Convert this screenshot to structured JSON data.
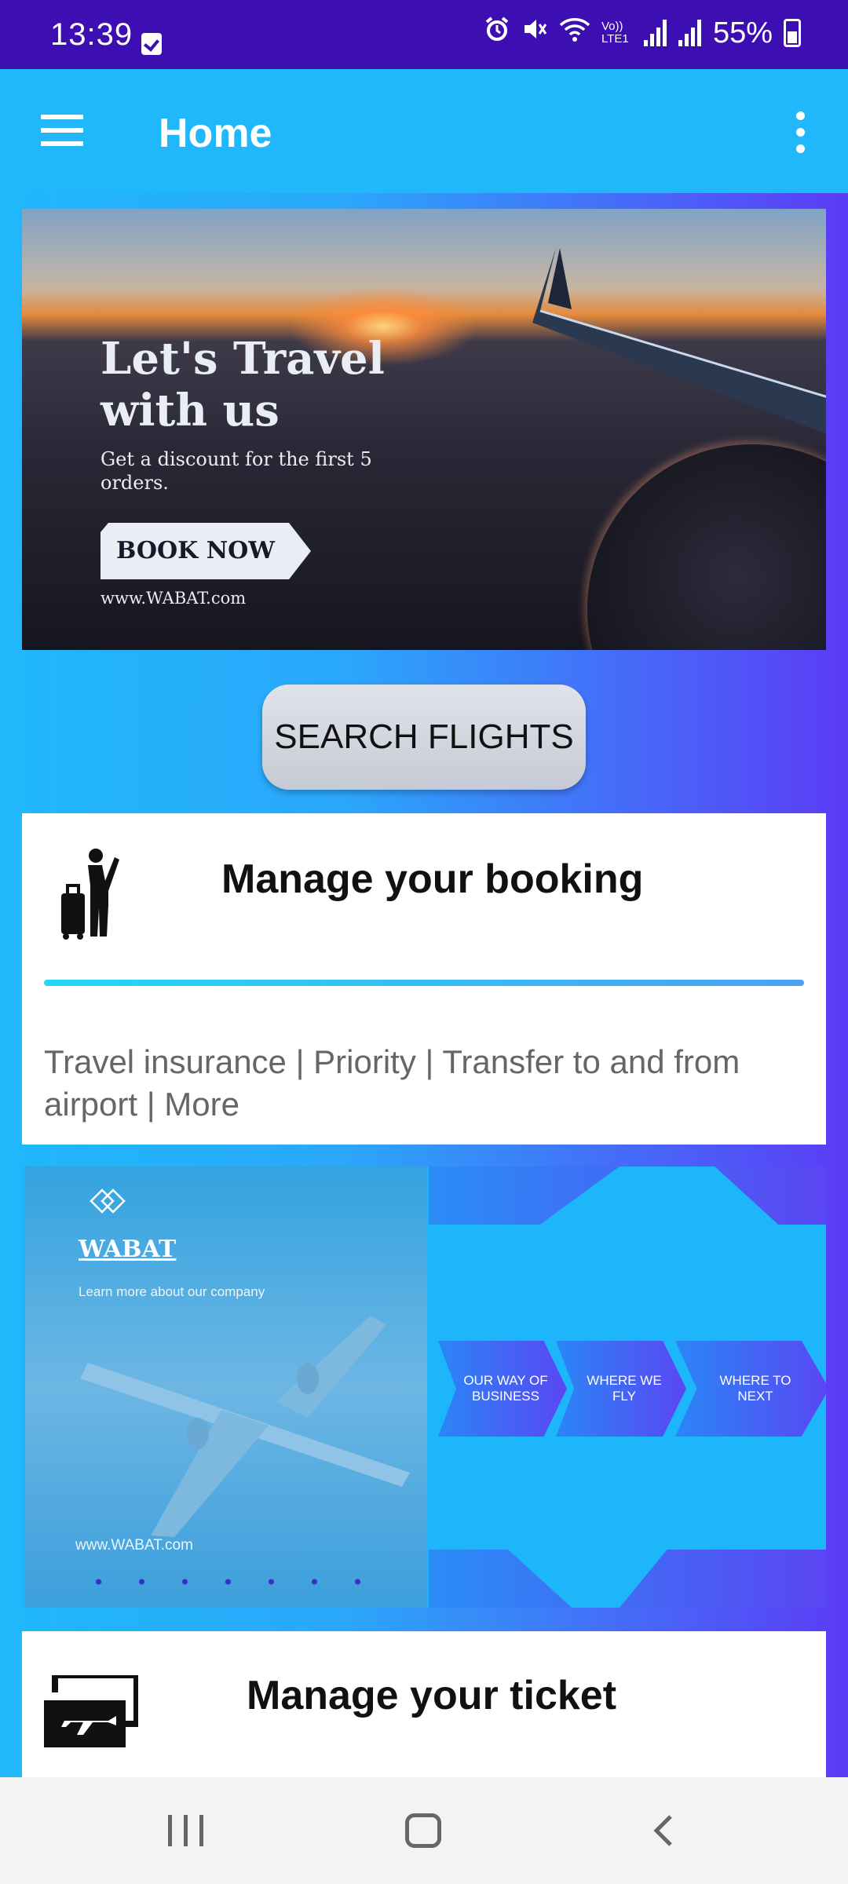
{
  "status_bar": {
    "time": "13:39",
    "battery": "55%",
    "network": "Vo)) LTE1",
    "icons": [
      "checkbox-icon",
      "alarm-icon",
      "mute-icon",
      "wifi-icon",
      "signal-icon",
      "signal-icon",
      "battery-icon"
    ]
  },
  "app_bar": {
    "title": "Home",
    "menu_icon": "hamburger-icon",
    "overflow_icon": "more-vert-icon"
  },
  "hero_banner": {
    "headline": "Let's Travel with us",
    "subtext": "Get a discount for the first 5 orders.",
    "cta": "BOOK NOW",
    "url": "www.WABAT.com"
  },
  "search_button": {
    "label": "SEARCH FLIGHTS"
  },
  "booking_card": {
    "title": "Manage your booking",
    "icon": "traveller-luggage-icon",
    "description": "Travel insurance | Priority | Transfer to and from airport | More"
  },
  "company_banner": {
    "brand": "WABAT",
    "tagline": "Learn more about our company",
    "url": "www.WABAT.com",
    "arrows": [
      "OUR WAY OF BUSINESS",
      "WHERE WE FLY",
      "WHERE TO NEXT"
    ]
  },
  "ticket_card": {
    "title": "Manage your ticket",
    "icon": "ticket-plane-icon"
  },
  "nav_bar": {
    "items": [
      "recent-apps",
      "home",
      "back"
    ]
  },
  "colors": {
    "status_bar": "#3d0fb3",
    "app_bar": "#20b8fb",
    "gradient_end": "#5b3cf6",
    "progress_line": "#22d8f4"
  }
}
